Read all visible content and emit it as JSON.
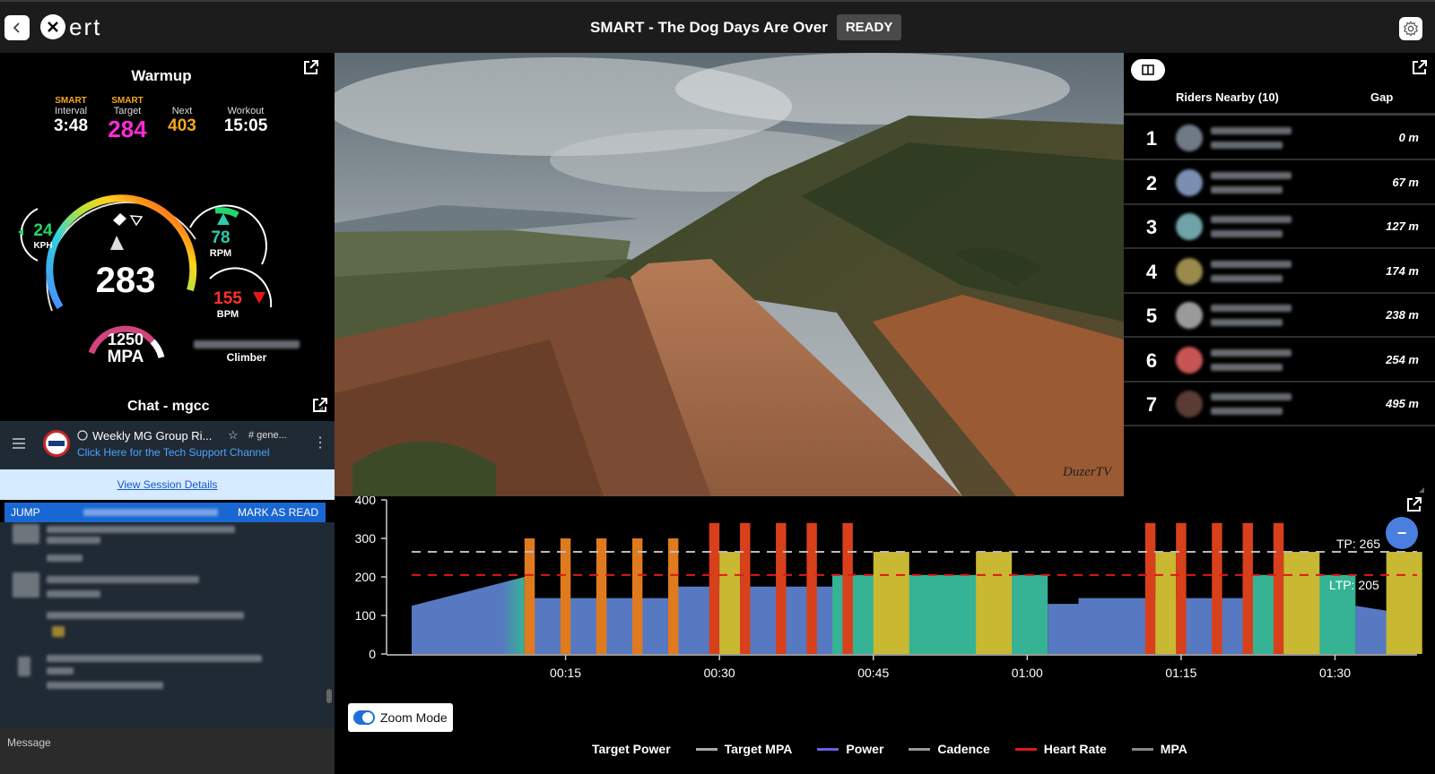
{
  "app": {
    "logo": "ert",
    "title": "SMART - The Dog Days Are Over",
    "status": "READY"
  },
  "dashboard": {
    "title": "Warmup",
    "stats": [
      {
        "smart": "SMART",
        "label": "Interval",
        "value": "3:48",
        "color": "#ffffff"
      },
      {
        "smart": "SMART",
        "label": "Target",
        "value": "284",
        "color": "#ff2bd6"
      },
      {
        "smart": "",
        "label": "Next",
        "value": "403",
        "color": "#f5a623"
      },
      {
        "smart": "",
        "label": "Workout",
        "value": "15:05",
        "color": "#ffffff"
      }
    ],
    "speed": {
      "value": "24",
      "unit": "KPH"
    },
    "power": "283",
    "cadence": {
      "value": "78",
      "unit": "RPM"
    },
    "heart_rate": {
      "value": "155",
      "unit": "BPM"
    },
    "mpa": {
      "value": "1250",
      "unit": "MPA"
    },
    "rider_type": "Climber"
  },
  "chat": {
    "title": "Chat - mgcc",
    "room": "Weekly MG Group Ri...",
    "channel_tag": "# gene...",
    "support_link": "Click Here for the Tech Support Channel",
    "view_session": "View Session Details",
    "jump": "JUMP",
    "mark_read": "MARK AS READ",
    "message_placeholder": "Message"
  },
  "video": {
    "watermark": "DuzerTV"
  },
  "riders": {
    "header": "Riders Nearby (10)",
    "gap_header": "Gap",
    "rows": [
      {
        "rank": "1",
        "gap": "0 m",
        "avatar": "#6f7a86"
      },
      {
        "rank": "2",
        "gap": "67 m",
        "avatar": "#7c8fb3"
      },
      {
        "rank": "3",
        "gap": "127 m",
        "avatar": "#6fa3a8"
      },
      {
        "rank": "4",
        "gap": "174 m",
        "avatar": "#9a8a4c"
      },
      {
        "rank": "5",
        "gap": "238 m",
        "avatar": "#9a9a9a"
      },
      {
        "rank": "6",
        "gap": "254 m",
        "avatar": "#c85454"
      },
      {
        "rank": "7",
        "gap": "495 m",
        "avatar": "#5a3c34"
      }
    ]
  },
  "chart_data": {
    "type": "bar",
    "ylim": [
      0,
      400
    ],
    "yticks": [
      "400",
      "300",
      "200",
      "100",
      "0"
    ],
    "xticks": [
      "00:15",
      "00:30",
      "00:45",
      "01:00",
      "01:15",
      "01:30"
    ],
    "xlim_seconds": [
      0,
      5880
    ],
    "tp": {
      "label": "TP: 265",
      "value": 265
    },
    "ltp": {
      "label": "LTP: 205",
      "value": 205
    },
    "segments": [
      {
        "start": 0,
        "end": 660,
        "from": 125,
        "to": 200,
        "kind": "ramp"
      },
      {
        "start": 660,
        "end": 1500,
        "value": 145,
        "kind": "base"
      },
      {
        "start": 1500,
        "end": 2460,
        "value": 175,
        "kind": "base"
      },
      {
        "start": 2460,
        "end": 3720,
        "value": 205,
        "kind": "tempo"
      },
      {
        "start": 3720,
        "end": 3900,
        "value": 130,
        "kind": "base"
      },
      {
        "start": 3900,
        "end": 4860,
        "value": 145,
        "kind": "base"
      },
      {
        "start": 4860,
        "end": 5520,
        "value": 205,
        "kind": "tempo"
      },
      {
        "start": 5520,
        "end": 5880,
        "from": 125,
        "to": 100,
        "kind": "ramp"
      }
    ],
    "bars": [
      {
        "start": 660,
        "end": 720,
        "value": 300,
        "kind": "orange"
      },
      {
        "start": 870,
        "end": 930,
        "value": 300,
        "kind": "orange"
      },
      {
        "start": 1080,
        "end": 1140,
        "value": 300,
        "kind": "orange"
      },
      {
        "start": 1290,
        "end": 1350,
        "value": 300,
        "kind": "orange"
      },
      {
        "start": 1500,
        "end": 1560,
        "value": 300,
        "kind": "orange"
      },
      {
        "start": 1740,
        "end": 1800,
        "value": 340,
        "kind": "red"
      },
      {
        "start": 1800,
        "end": 1920,
        "value": 265,
        "kind": "yellow"
      },
      {
        "start": 1920,
        "end": 1980,
        "value": 340,
        "kind": "red"
      },
      {
        "start": 2130,
        "end": 2190,
        "value": 340,
        "kind": "red"
      },
      {
        "start": 2310,
        "end": 2370,
        "value": 340,
        "kind": "red"
      },
      {
        "start": 2520,
        "end": 2580,
        "value": 340,
        "kind": "red"
      },
      {
        "start": 2700,
        "end": 2910,
        "value": 265,
        "kind": "yellow"
      },
      {
        "start": 3300,
        "end": 3510,
        "value": 265,
        "kind": "yellow"
      },
      {
        "start": 4290,
        "end": 4350,
        "value": 340,
        "kind": "red"
      },
      {
        "start": 4350,
        "end": 4470,
        "value": 265,
        "kind": "yellow"
      },
      {
        "start": 4470,
        "end": 4530,
        "value": 340,
        "kind": "red"
      },
      {
        "start": 4680,
        "end": 4740,
        "value": 340,
        "kind": "red"
      },
      {
        "start": 4860,
        "end": 4920,
        "value": 340,
        "kind": "red"
      },
      {
        "start": 5040,
        "end": 5100,
        "value": 340,
        "kind": "red"
      },
      {
        "start": 5100,
        "end": 5310,
        "value": 265,
        "kind": "yellow"
      },
      {
        "start": 5700,
        "end": 5910,
        "value": 265,
        "kind": "yellow"
      }
    ],
    "colors": {
      "base": "#5779c1",
      "tempo": "#35b394",
      "ramp": "#5779c1",
      "orange": "#e07a1f",
      "red": "#d8401b",
      "yellow": "#c9b832",
      "tp_line": "#bbbbbb",
      "ltp_line": "#e01818"
    },
    "legend": [
      {
        "label": "Target Power",
        "color": ""
      },
      {
        "label": "Target MPA",
        "color": "#aaaaaa"
      },
      {
        "label": "Power",
        "color": "#6a5fe0"
      },
      {
        "label": "Cadence",
        "color": "#999999"
      },
      {
        "label": "Heart Rate",
        "color": "#e01818"
      },
      {
        "label": "MPA",
        "color": "#888888"
      }
    ],
    "zoom_label": "Zoom Mode",
    "collapse_label": "−"
  }
}
